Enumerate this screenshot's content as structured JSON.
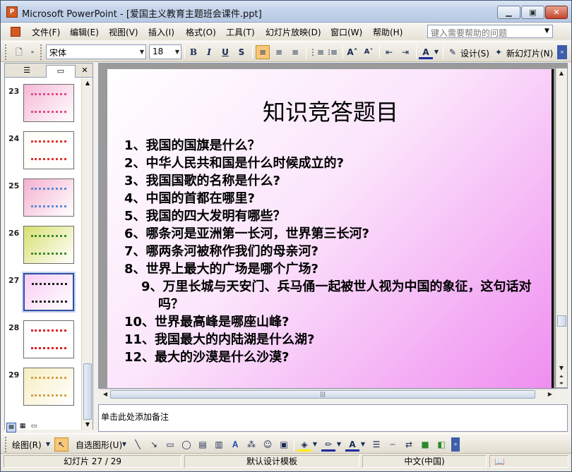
{
  "window": {
    "app": "Microsoft PowerPoint",
    "title": "Microsoft PowerPoint - [爱国主义教育主题班会课件.ppt]",
    "icon": "powerpoint-icon"
  },
  "menu": {
    "items": [
      "文件(F)",
      "编辑(E)",
      "视图(V)",
      "插入(I)",
      "格式(O)",
      "工具(T)",
      "幻灯片放映(D)",
      "窗口(W)",
      "帮助(H)"
    ],
    "help_placeholder": "键入需要帮助的问题"
  },
  "toolbar": {
    "font": "宋体",
    "size": "18",
    "bold": "B",
    "italic": "I",
    "underline": "U",
    "shadow": "S",
    "design_label": "设计(S)",
    "new_slide_label": "新幻灯片(N)",
    "font_color_glyph": "A"
  },
  "slides_panel": {
    "slides": [
      {
        "num": "23",
        "bg": "#f5b8d6",
        "accent": "#e04a8a"
      },
      {
        "num": "24",
        "bg": "#fdfcf6",
        "accent": "#d33"
      },
      {
        "num": "25",
        "bg": "#f6b0cf",
        "accent": "#5a8ad6"
      },
      {
        "num": "26",
        "bg": "#d8e070",
        "accent": "#3d8a2c"
      },
      {
        "num": "27",
        "bg": "#f9cdf5",
        "accent": "#222"
      },
      {
        "num": "28",
        "bg": "#ffffff",
        "accent": "#e21b1b"
      },
      {
        "num": "29",
        "bg": "#f7eec2",
        "accent": "#d4a04a"
      }
    ],
    "selected": "27"
  },
  "slide": {
    "title": "知识竞答题目",
    "questions": [
      "1、我国的国旗是什么？",
      "2、中华人民共和国是什么时候成立的?",
      "3、我国国歌的名称是什么?",
      "4、中国的首都在哪里?",
      "5、我国的四大发明有哪些？",
      "6、哪条河是亚洲第一长河，世界第三长河?",
      "7、哪两条河被称作我们的母亲河?",
      "8、世界上最大的广场是哪个广场?",
      "9、万里长城与天安门、兵马俑一起被世人视为中国的象征，这句话对吗？",
      "10、世界最高峰是哪座山峰?",
      "11、我国最大的内陆湖是什么湖?",
      "12、最大的沙漠是什么沙漠?"
    ]
  },
  "notes": {
    "placeholder": "单击此处添加备注"
  },
  "drawing": {
    "draw_label": "绘图(R)",
    "autoshape_label": "自选图形(U)"
  },
  "status": {
    "slide": "幻灯片 27 / 29",
    "template": "默认设计模板",
    "language": "中文(中国)"
  }
}
